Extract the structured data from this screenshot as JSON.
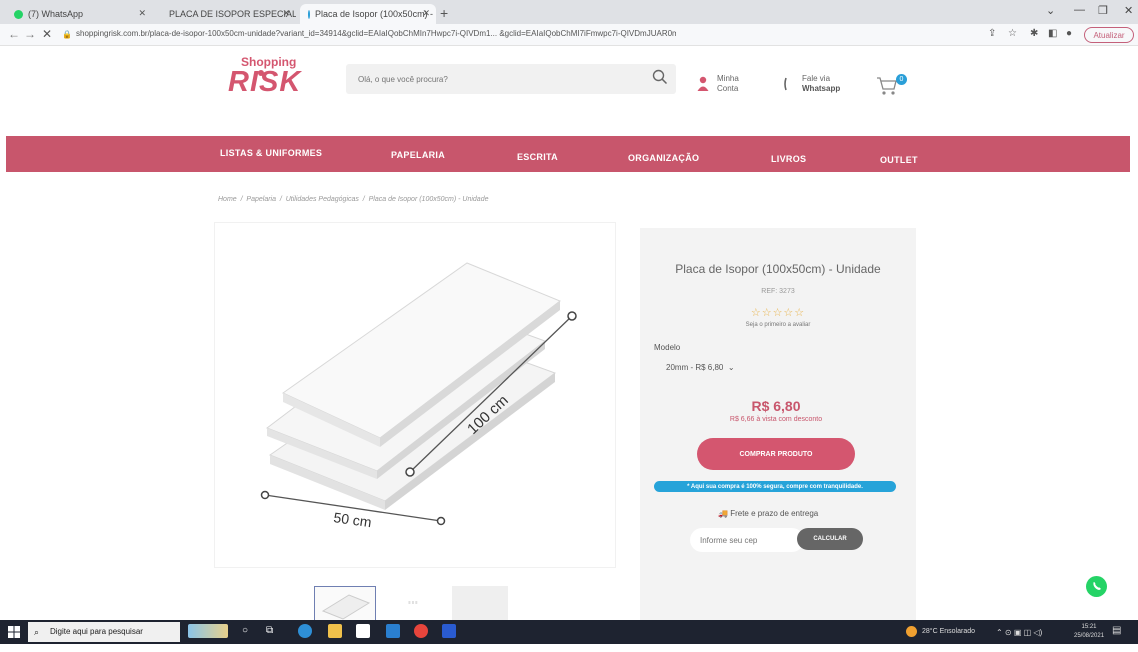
{
  "browser": {
    "tabs": [
      {
        "label": "(7) WhatsApp"
      },
      {
        "label": "PLACA DE ISOPOR ESPECIAL 20"
      },
      {
        "label": "Placa de Isopor (100x50cm) - U"
      }
    ],
    "url": "shoppingrisk.com.br/placa-de-isopor-100x50cm-unidade?variant_id=34914&gclid=EAIaIQobChMIn7Hwpc7i-QIVDm1... &gclid=EAIaIQobChMI7iFmwpc7i-QIVDmJUAR0mugZHEAQYASABEgK-3FD_BwE",
    "update_label": "Atualizar"
  },
  "header": {
    "logo_top": "Shopping",
    "logo_main": "RISK",
    "search_placeholder": "Olá, o que você procura?",
    "account_line1": "Minha",
    "account_line2": "Conta",
    "whatsapp_line1": "Fale via",
    "whatsapp_line2": "Whatsapp",
    "cart_count": "0"
  },
  "nav": {
    "items": [
      "LISTAS & UNIFORMES",
      "PAPELARIA",
      "ESCRITA",
      "ORGANIZAÇÃO",
      "LIVROS",
      "OUTLET"
    ]
  },
  "breadcrumb": {
    "items": [
      "Home",
      "Papelaria",
      "Utilidades Pedagógicas",
      "Placa de Isopor (100x50cm) - Unidade"
    ]
  },
  "product": {
    "image_label_long": "100 cm",
    "image_label_short": "50 cm",
    "title": "Placa de Isopor (100x50cm) - Unidade",
    "ref": "REF: 3273",
    "rating_text": "Seja o primeiro a avaliar",
    "model_label": "Modelo",
    "model_selected": "20mm - R$ 6,80",
    "price": "R$ 6,80",
    "price_discount": "R$ 6,66 à vista com desconto",
    "buy_label": "COMPRAR PRODUTO",
    "secure_text": "* Aqui sua compra é 100% segura, compre com tranquilidade.",
    "shipping_label": "Frete e prazo de entrega",
    "cep_placeholder": "Informe seu cep",
    "calc_label": "CALCULAR"
  },
  "taskbar": {
    "search_placeholder": "Digite aqui para pesquisar",
    "weather": "28°C  Ensolarado",
    "time": "15:21",
    "date": "25/08/2021"
  },
  "colors": {
    "brand": "#c8566c",
    "accent_blue": "#26a3d9",
    "whatsapp": "#25d366"
  }
}
